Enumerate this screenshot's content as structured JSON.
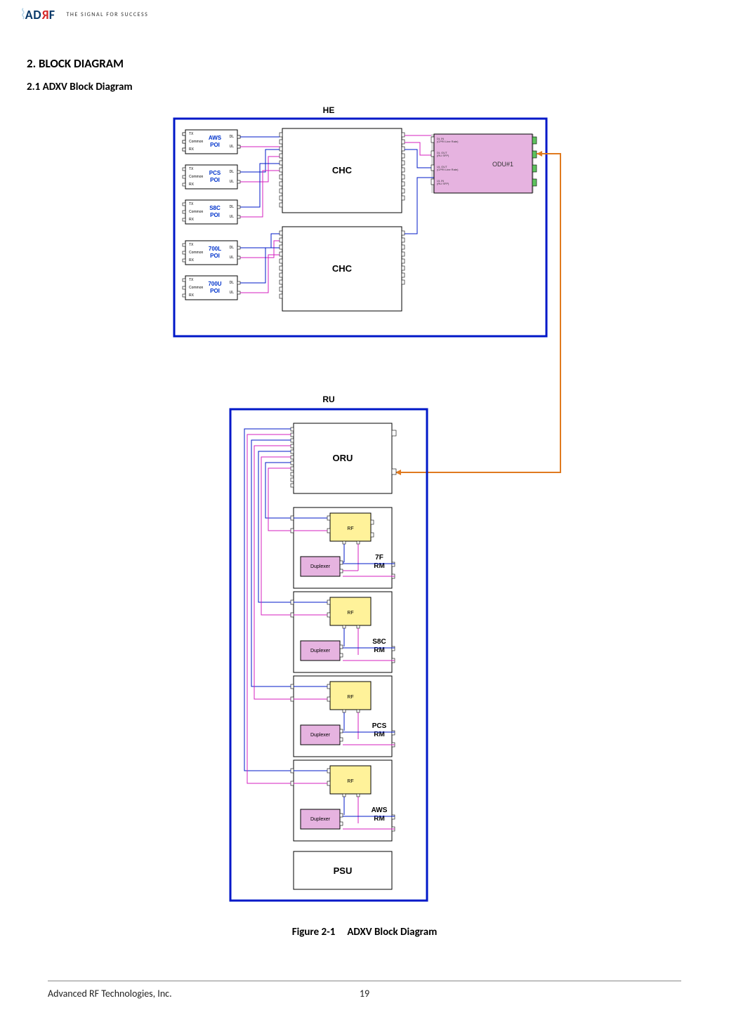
{
  "header": {
    "logo_letters": {
      "a": "A",
      "d": "D",
      "r": "R",
      "f": "F"
    },
    "tagline": "THE SIGNAL FOR SUCCESS"
  },
  "section": {
    "num_title": "2.    BLOCK DIAGRAM",
    "sub_title": "2.1  ADXV Block Diagram"
  },
  "diagram": {
    "he_label": "HE",
    "ru_label": "RU",
    "chc": "CHC",
    "odu": "ODU#1",
    "odu_ports": {
      "dl_in": "DL IN",
      "dl_in_sub": "(CPRI Line Rate)",
      "ul_out": "UL OUT",
      "ul_out_sub": "(CPRI Line Rate)",
      "dl_out": "DL OUT",
      "dl_out_sub": "(RU SFP)",
      "ul_in": "UL IN",
      "ul_in_sub": "(RU SFP)"
    },
    "poi": [
      {
        "brand": "AWS",
        "label": "POI"
      },
      {
        "brand": "PCS",
        "label": "POI"
      },
      {
        "brand": "S8C",
        "label": "POI"
      },
      {
        "brand": "700L",
        "label": "POI"
      },
      {
        "brand": "700U",
        "label": "POI"
      }
    ],
    "poi_ports": {
      "tx": "TX",
      "common": "Common",
      "rx": "RX",
      "dl": "DL",
      "ul": "UL"
    },
    "oru": "ORU",
    "psu": "PSU",
    "rm": [
      {
        "rf": "RF",
        "dup": "Duplexer",
        "name1": "7F",
        "name2": "RM"
      },
      {
        "rf": "RF",
        "dup": "Duplexer",
        "name1": "S8C",
        "name2": "RM"
      },
      {
        "rf": "RF",
        "dup": "Duplexer",
        "name1": "PCS",
        "name2": "RM"
      },
      {
        "rf": "RF",
        "dup": "Duplexer",
        "name1": "AWS",
        "name2": "RM"
      }
    ]
  },
  "figure_caption_num": "Figure 2-1",
  "figure_caption_txt": "ADXV Block Diagram",
  "footer": {
    "company": "Advanced RF Technologies, Inc.",
    "page": "19"
  }
}
